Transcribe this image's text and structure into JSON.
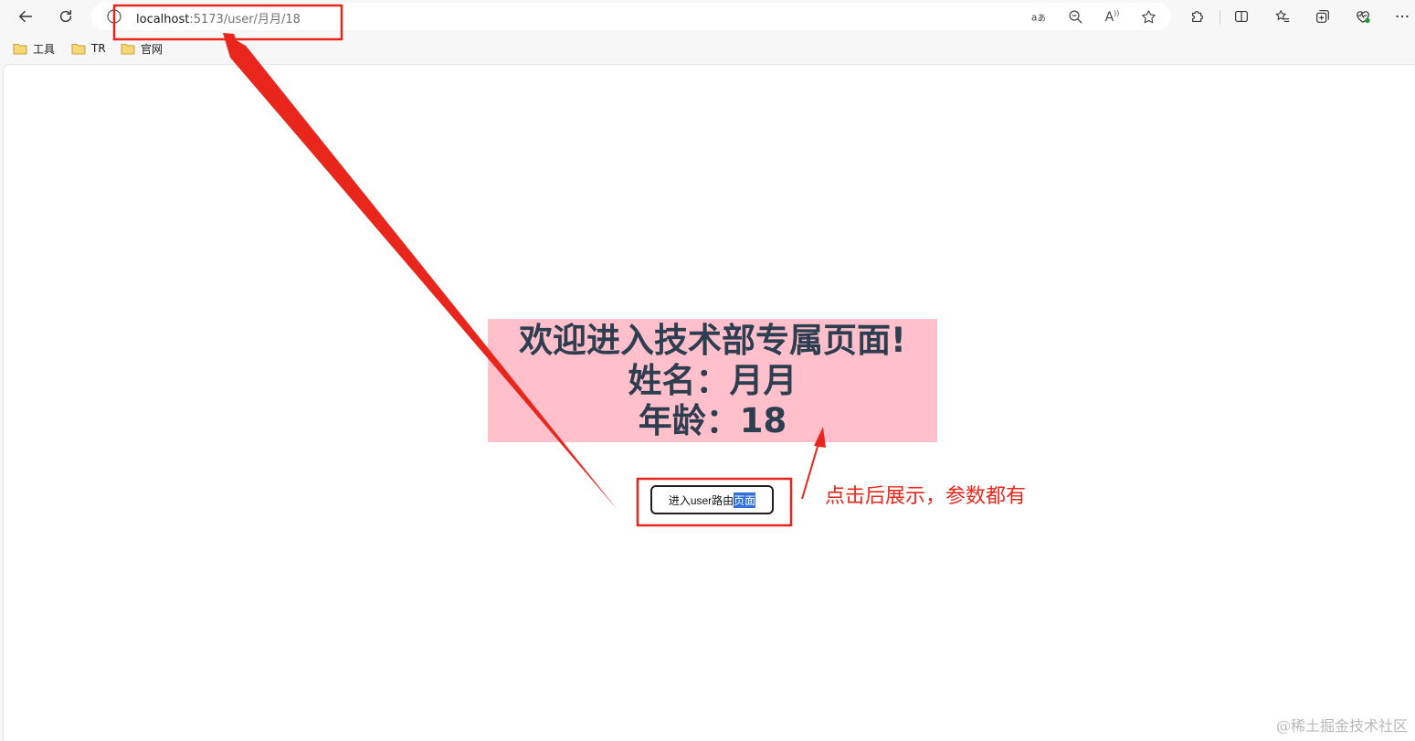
{
  "browser": {
    "url_host": "localhost",
    "url_rest": ":5173/user/月月/18",
    "read_aloud_glyph": "A",
    "bookmarks": [
      {
        "label": "工具"
      },
      {
        "label": "TR"
      },
      {
        "label": "官网"
      }
    ]
  },
  "page": {
    "heading": "欢迎进入技术部专属页面!",
    "name_line": "姓名：月月",
    "age_line": "年龄：18",
    "button_label_main": "进入user路由",
    "button_label_selected": "页面",
    "panel_background": "#ffc0cb",
    "text_color": "#2c3e50"
  },
  "annotation": {
    "note": "点击后展示，参数都有",
    "color": "#e8261c"
  },
  "watermark": "@稀土掘金技术社区"
}
